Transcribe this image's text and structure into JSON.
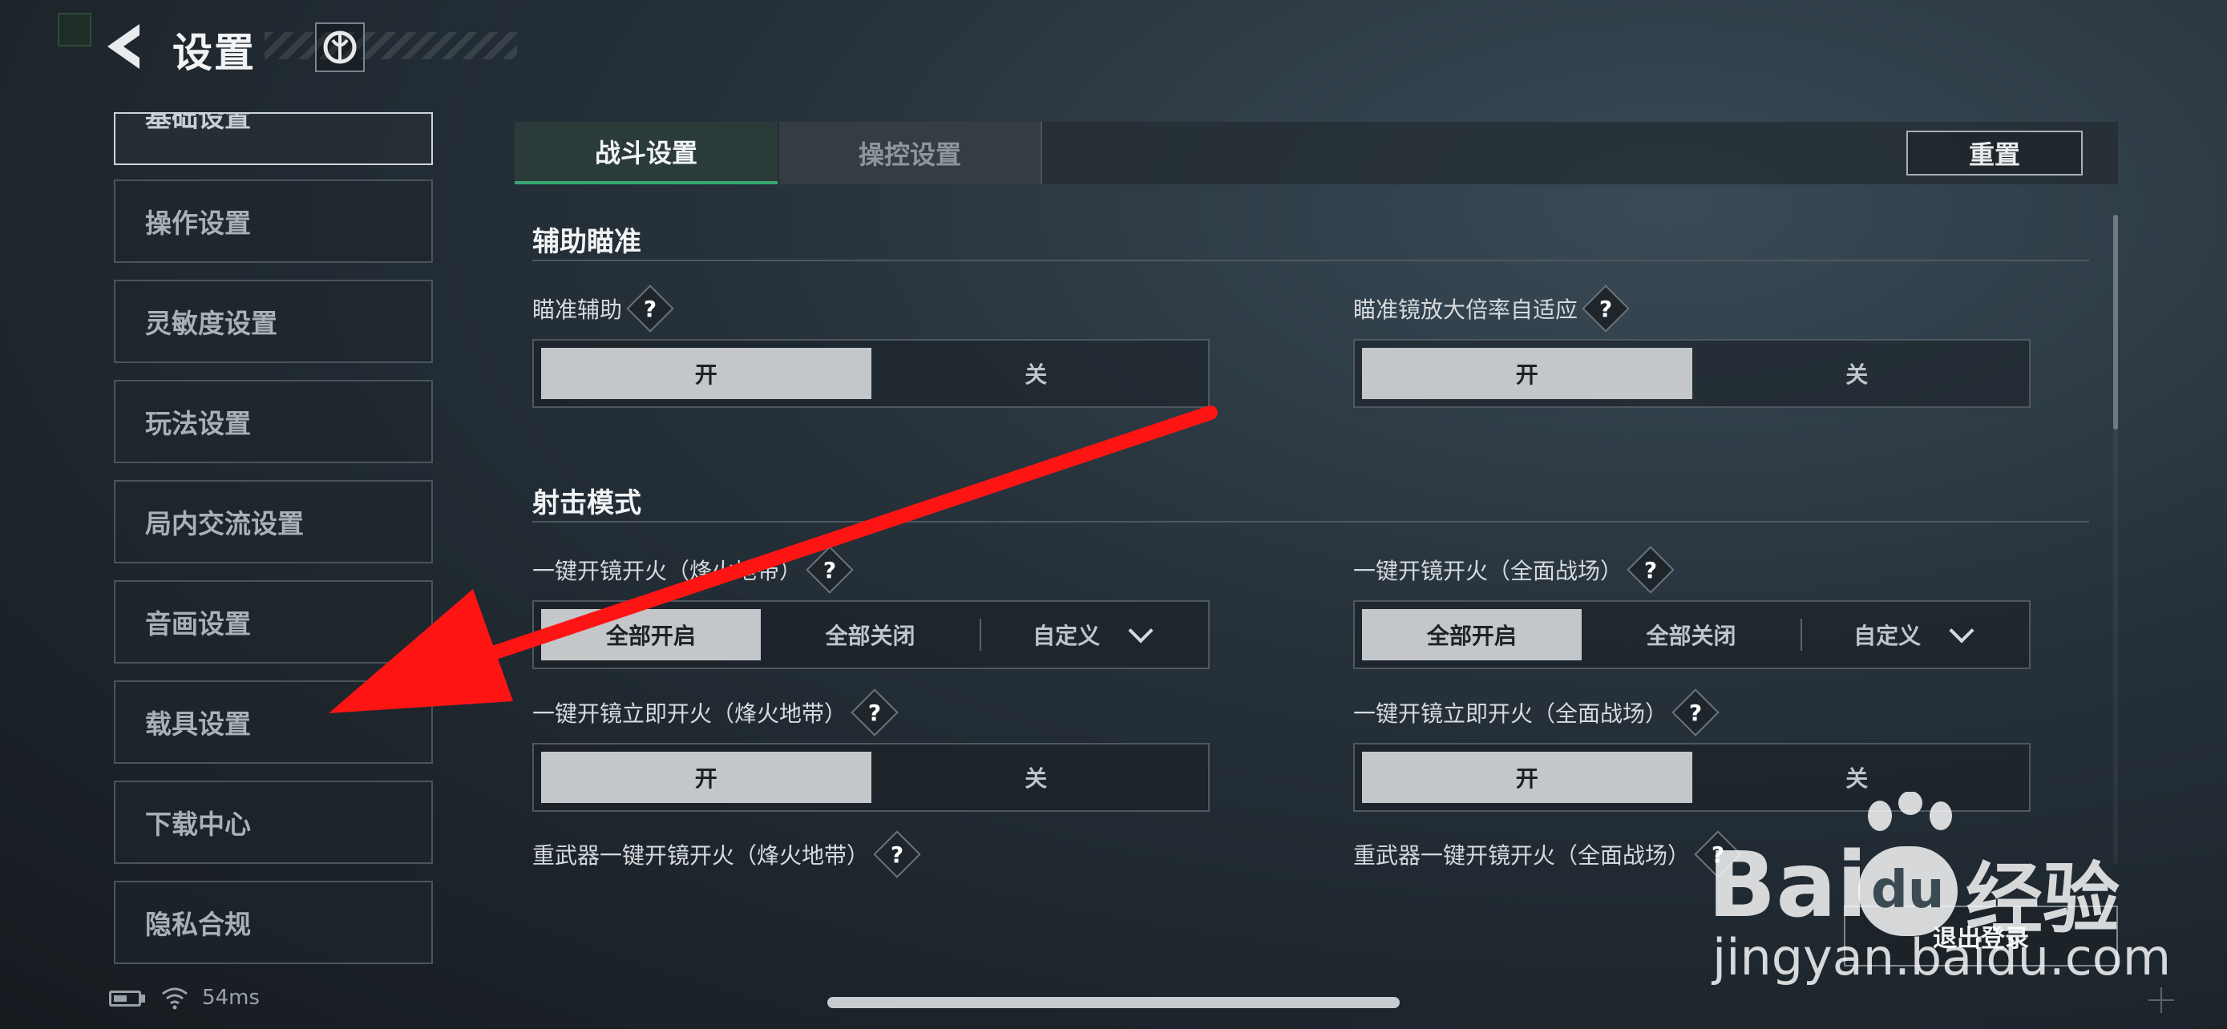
{
  "header": {
    "title": "设置",
    "back_icon": "back-arrow-icon",
    "logo_icon": "game-logo-icon"
  },
  "sidebar": {
    "items": [
      {
        "label": "基础设置",
        "active": true
      },
      {
        "label": "操作设置",
        "active": false
      },
      {
        "label": "灵敏度设置",
        "active": false
      },
      {
        "label": "玩法设置",
        "active": false
      },
      {
        "label": "局内交流设置",
        "active": false
      },
      {
        "label": "音画设置",
        "active": false
      },
      {
        "label": "载具设置",
        "active": false
      },
      {
        "label": "下载中心",
        "active": false
      },
      {
        "label": "隐私合规",
        "active": false
      }
    ]
  },
  "tabs": [
    {
      "label": "战斗设置",
      "active": true
    },
    {
      "label": "操控设置",
      "active": false
    }
  ],
  "reset_label": "重置",
  "help_glyph": "?",
  "sections": {
    "aim_assist": {
      "title": "辅助瞄准",
      "settings": [
        {
          "label": "瞄准辅助",
          "options": [
            "开",
            "关"
          ],
          "selected": "开"
        },
        {
          "label": "瞄准镜放大倍率自适应",
          "options": [
            "开",
            "关"
          ],
          "selected": "开"
        }
      ]
    },
    "fire_mode": {
      "title": "射击模式",
      "settings": [
        {
          "label": "一键开镜开火（烽火地带）",
          "options": [
            "全部开启",
            "全部关闭",
            "自定义"
          ],
          "selected": "全部开启"
        },
        {
          "label": "一键开镜开火（全面战场）",
          "options": [
            "全部开启",
            "全部关闭",
            "自定义"
          ],
          "selected": "全部开启"
        },
        {
          "label": "一键开镜立即开火（烽火地带）",
          "options": [
            "开",
            "关"
          ],
          "selected": "开"
        },
        {
          "label": "一键开镜立即开火（全面战场）",
          "options": [
            "开",
            "关"
          ],
          "selected": "开"
        },
        {
          "label": "重武器一键开镜开火（烽火地带）"
        },
        {
          "label": "重武器一键开镜开火（全面战场）"
        }
      ]
    }
  },
  "status": {
    "ping": "54ms",
    "battery_icon": "battery-icon",
    "wifi_icon": "wifi-icon"
  },
  "logout_label": "退出登录",
  "watermark": {
    "brand_left": "Bai",
    "brand_du": "du",
    "brand_right": "经验",
    "url": "jingyan.baidu.com"
  },
  "colors": {
    "accent": "#3aa874",
    "annotation_arrow": "#ff1414",
    "selected_segment": "#c3c7ca"
  }
}
